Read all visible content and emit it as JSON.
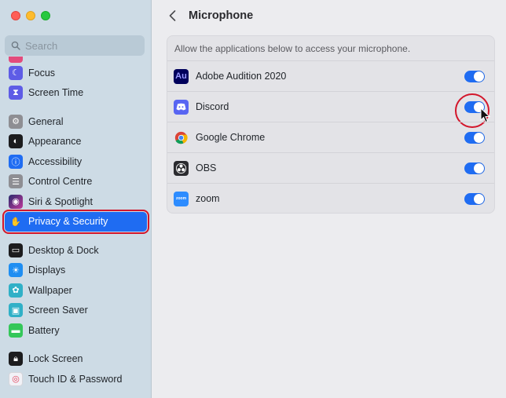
{
  "window": {
    "title": "Microphone"
  },
  "search": {
    "placeholder": "Search"
  },
  "sidebar": {
    "items": [
      {
        "label": "Focus",
        "icon": "moon-icon",
        "color": "#5e5ce6"
      },
      {
        "label": "Screen Time",
        "icon": "hourglass-icon",
        "color": "#5e5ce6"
      },
      {
        "label": "General",
        "icon": "gear-icon",
        "color": "#8e8e93"
      },
      {
        "label": "Appearance",
        "icon": "appearance-icon",
        "color": "#1c1c1e"
      },
      {
        "label": "Accessibility",
        "icon": "accessibility-icon",
        "color": "#1f6cf2"
      },
      {
        "label": "Control Centre",
        "icon": "control-centre-icon",
        "color": "#8e8e93"
      },
      {
        "label": "Siri & Spotlight",
        "icon": "siri-icon",
        "color": "#3a3a8c"
      },
      {
        "label": "Privacy & Security",
        "icon": "hand-icon",
        "color": "#1f6cf2"
      },
      {
        "label": "Desktop & Dock",
        "icon": "dock-icon",
        "color": "#1c1c1e"
      },
      {
        "label": "Displays",
        "icon": "sun-icon",
        "color": "#1f8ef2"
      },
      {
        "label": "Wallpaper",
        "icon": "wallpaper-icon",
        "color": "#30b0c7"
      },
      {
        "label": "Screen Saver",
        "icon": "screen-saver-icon",
        "color": "#30b0c7"
      },
      {
        "label": "Battery",
        "icon": "battery-icon",
        "color": "#34c759"
      },
      {
        "label": "Lock Screen",
        "icon": "lock-icon",
        "color": "#1c1c1e"
      },
      {
        "label": "Touch ID & Password",
        "icon": "fingerprint-icon",
        "color": "#f2f2f7"
      }
    ],
    "active": "Privacy & Security"
  },
  "main": {
    "description": "Allow the applications below to access your microphone.",
    "apps": [
      {
        "name": "Adobe Audition 2020",
        "icon": "adobe-audition-icon",
        "icon_text": "Au",
        "enabled": true
      },
      {
        "name": "Discord",
        "icon": "discord-icon",
        "enabled": true
      },
      {
        "name": "Google Chrome",
        "icon": "chrome-icon",
        "enabled": true
      },
      {
        "name": "OBS",
        "icon": "obs-icon",
        "enabled": true
      },
      {
        "name": "zoom",
        "icon": "zoom-icon",
        "icon_text": "zoom",
        "enabled": true
      }
    ]
  },
  "colors": {
    "accent": "#1f6cf2",
    "annotation": "#d3162b"
  }
}
